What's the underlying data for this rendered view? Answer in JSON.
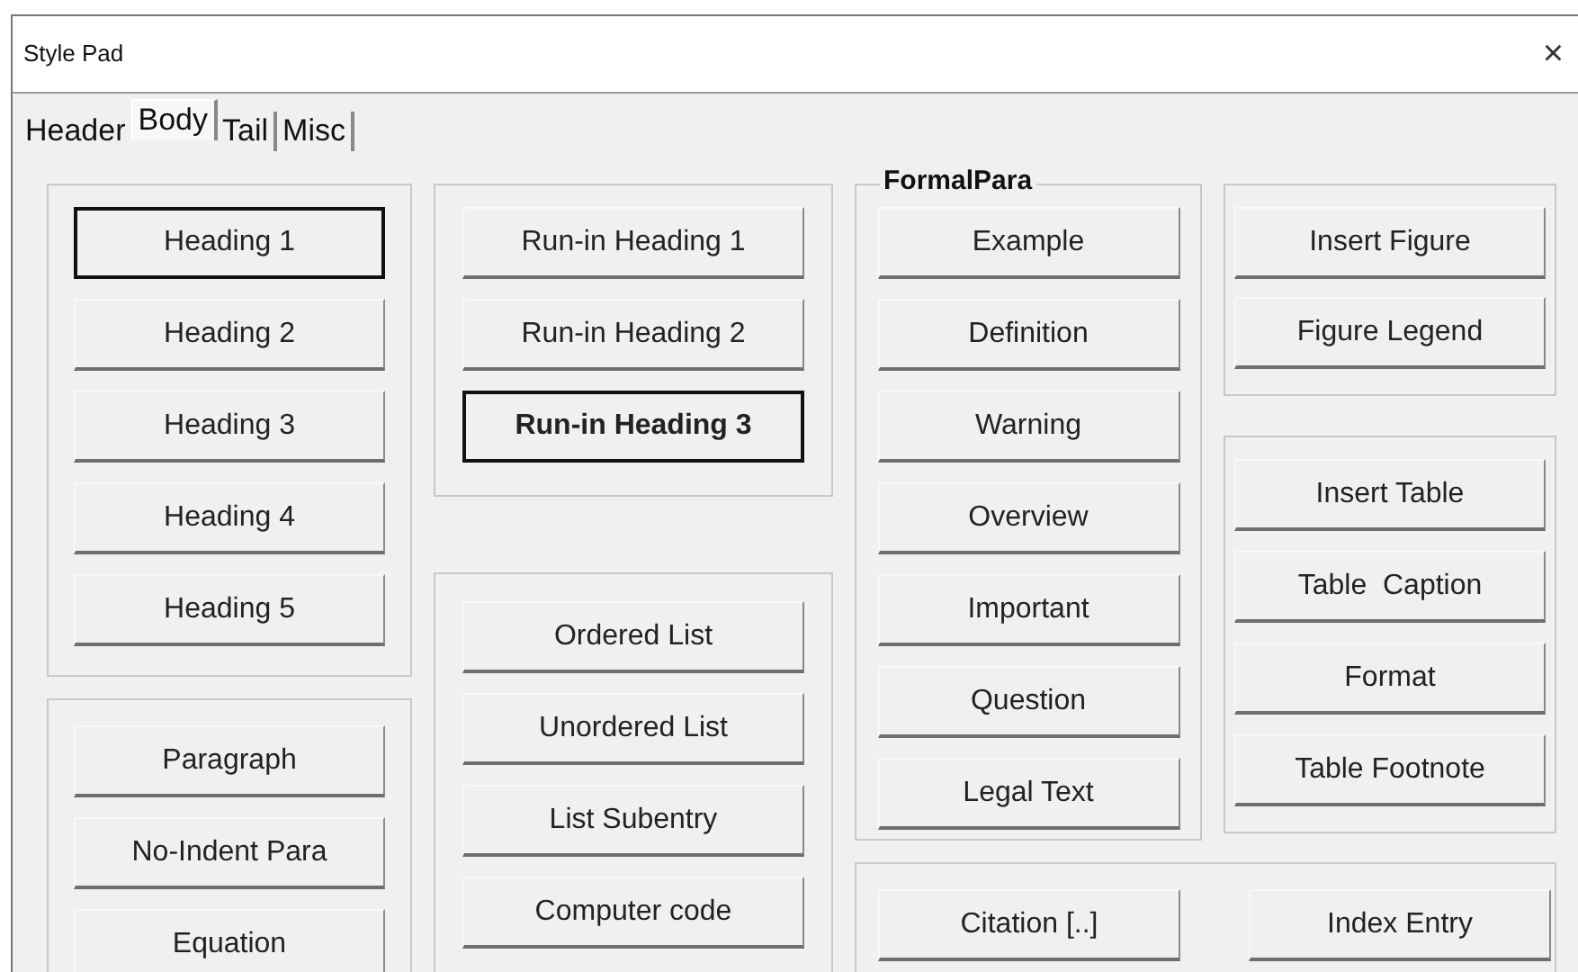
{
  "window": {
    "title": "Style Pad",
    "close": "×"
  },
  "tabs": [
    {
      "label": "Header",
      "selected": false
    },
    {
      "label": "Body",
      "selected": true
    },
    {
      "label": "Tail",
      "selected": false
    },
    {
      "label": "Misc",
      "selected": false
    }
  ],
  "columns": [
    {
      "groups": [
        {
          "buttons": [
            {
              "label": "Heading 1",
              "focused": true,
              "bold": false
            },
            {
              "label": "Heading 2",
              "focused": false,
              "bold": false
            },
            {
              "label": "Heading 3",
              "focused": false,
              "bold": false
            },
            {
              "label": "Heading 4",
              "focused": false,
              "bold": false
            },
            {
              "label": "Heading 5",
              "focused": false,
              "bold": false
            }
          ]
        },
        {
          "buttons": [
            {
              "label": "Paragraph",
              "focused": false,
              "bold": false
            },
            {
              "label": "No-Indent Para",
              "focused": false,
              "bold": false
            },
            {
              "label": "Equation",
              "focused": false,
              "bold": false
            }
          ]
        }
      ]
    },
    {
      "groups": [
        {
          "buttons": [
            {
              "label": "Run-in Heading 1",
              "focused": false,
              "bold": false
            },
            {
              "label": "Run-in Heading 2",
              "focused": false,
              "bold": false
            },
            {
              "label": "Run-in Heading 3",
              "focused": true,
              "bold": true
            }
          ]
        },
        {
          "buttons": [
            {
              "label": "Ordered List",
              "focused": false,
              "bold": false
            },
            {
              "label": "Unordered List",
              "focused": false,
              "bold": false
            },
            {
              "label": "List Subentry",
              "focused": false,
              "bold": false
            },
            {
              "label": "Computer code",
              "focused": false,
              "bold": false
            }
          ]
        }
      ]
    },
    {
      "groups": [
        {
          "legend": "FormalPara",
          "buttons": [
            {
              "label": "Example",
              "focused": false,
              "bold": false
            },
            {
              "label": "Definition",
              "focused": false,
              "bold": false
            },
            {
              "label": "Warning",
              "focused": false,
              "bold": false
            },
            {
              "label": "Overview",
              "focused": false,
              "bold": false
            },
            {
              "label": "Important",
              "focused": false,
              "bold": false
            },
            {
              "label": "Question",
              "focused": false,
              "bold": false
            },
            {
              "label": "Legal Text",
              "focused": false,
              "bold": false
            }
          ]
        }
      ]
    },
    {
      "groups": [
        {
          "buttons": [
            {
              "label": "Insert Figure",
              "focused": false,
              "bold": false
            },
            {
              "label": "Figure Legend",
              "focused": false,
              "bold": false
            }
          ]
        },
        {
          "buttons": [
            {
              "label": "Insert Table",
              "focused": false,
              "bold": false
            },
            {
              "label": "Table  Caption",
              "focused": false,
              "bold": false
            },
            {
              "label": "Format",
              "focused": false,
              "bold": false
            },
            {
              "label": "Table Footnote",
              "focused": false,
              "bold": false
            }
          ]
        }
      ]
    }
  ],
  "bottom_group": {
    "buttons": [
      {
        "label": "Citation [..]",
        "focused": false,
        "bold": false
      },
      {
        "label": "Index Entry",
        "focused": false,
        "bold": false
      }
    ]
  }
}
